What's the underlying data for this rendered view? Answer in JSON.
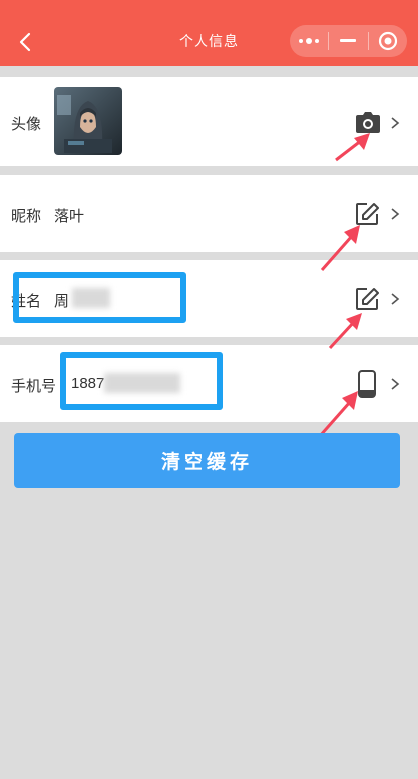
{
  "header": {
    "title": "个人信息",
    "back_icon": "chevron-left-icon",
    "menu_icon": "more-dots-icon",
    "minimize_icon": "minus-icon",
    "close_icon": "target-circle-icon",
    "bg_color": "#f45c4e"
  },
  "rows": {
    "avatar": {
      "label": "头像",
      "action_icon": "camera-icon"
    },
    "nickname": {
      "label": "昵称",
      "value": "落叶",
      "action_icon": "edit-icon"
    },
    "name": {
      "label": "姓名",
      "value": "周",
      "action_icon": "edit-icon"
    },
    "phone": {
      "label": "手机号",
      "value": "1887",
      "action_icon": "phone-icon"
    }
  },
  "clear_cache": {
    "label": "清空缓存",
    "color": "#3ea0f3"
  },
  "annotations": {
    "box_color": "#1da1f2",
    "arrow_color": "#f2455a"
  }
}
